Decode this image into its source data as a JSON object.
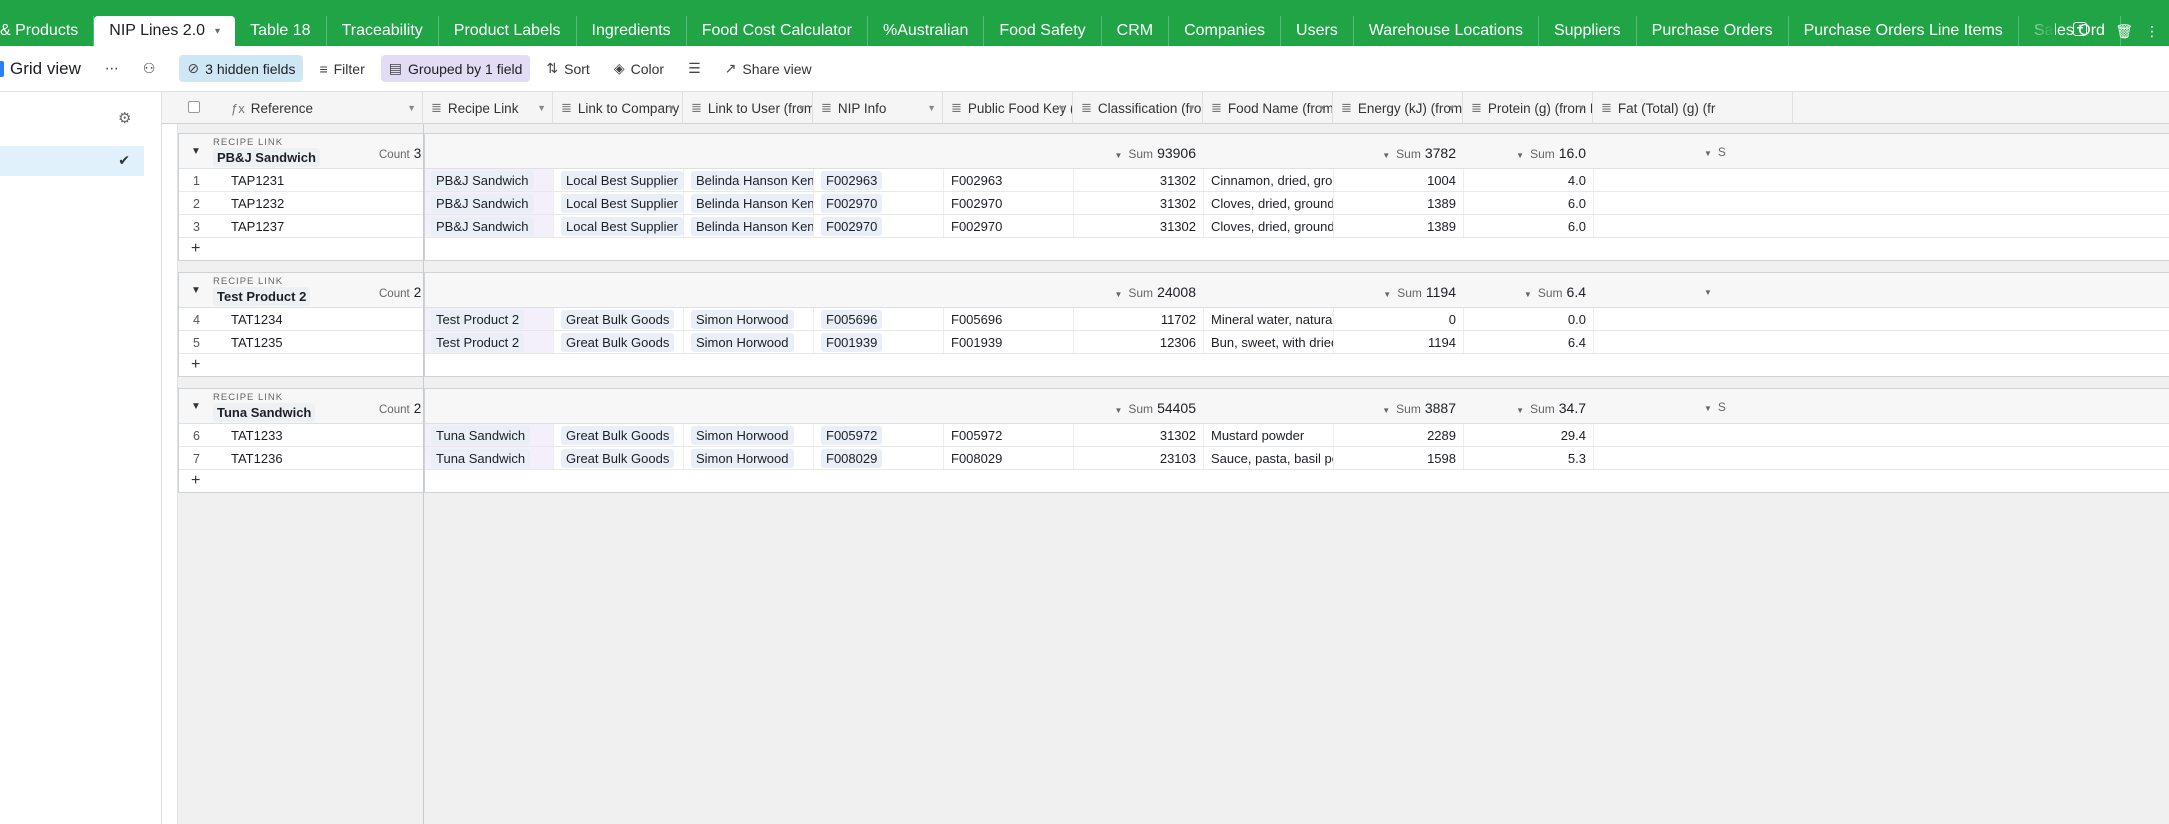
{
  "tabs": [
    {
      "label": "& Products"
    },
    {
      "label": "NIP Lines 2.0",
      "active": true
    },
    {
      "label": "Table 18"
    },
    {
      "label": "Traceability"
    },
    {
      "label": "Product Labels"
    },
    {
      "label": "Ingredients"
    },
    {
      "label": "Food Cost Calculator"
    },
    {
      "label": "%Australian"
    },
    {
      "label": "Food Safety"
    },
    {
      "label": "CRM"
    },
    {
      "label": "Companies"
    },
    {
      "label": "Users"
    },
    {
      "label": "Warehouse Locations"
    },
    {
      "label": "Suppliers"
    },
    {
      "label": "Purchase Orders"
    },
    {
      "label": "Purchase Orders Line Items"
    },
    {
      "label": "Sales Ord"
    }
  ],
  "viewbar": {
    "view_name": "Grid view",
    "hidden_fields": "3 hidden fields",
    "filter": "Filter",
    "grouped": "Grouped by 1 field",
    "sort": "Sort",
    "color": "Color",
    "share": "Share view"
  },
  "columns": [
    {
      "label": "Reference",
      "icon": "formula-icon"
    },
    {
      "label": "Recipe Link",
      "icon": "lines-icon"
    },
    {
      "label": "Link to Company (fr...",
      "icon": "lines-icon"
    },
    {
      "label": "Link to User (from ...",
      "icon": "lines-icon"
    },
    {
      "label": "NIP Info",
      "icon": "lines-icon"
    },
    {
      "label": "Public Food Key (fr...",
      "icon": "lines-icon"
    },
    {
      "label": "Classification (from...",
      "icon": "lines-icon"
    },
    {
      "label": "Food Name (from N...",
      "icon": "lines-icon"
    },
    {
      "label": "Energy (kJ) (from N...",
      "icon": "lines-icon"
    },
    {
      "label": "Protein (g) (from NI...",
      "icon": "lines-icon"
    },
    {
      "label": "Fat (Total) (g) (fr",
      "icon": "lines-icon"
    }
  ],
  "groups": [
    {
      "label": "RECIPE LINK",
      "name": "PB&J Sandwich",
      "count_label": "Count",
      "count": "3",
      "sum_label": "Sum",
      "sum_classification": "93906",
      "sum_energy": "3782",
      "sum_protein": "16.0",
      "sum_fat_partial": "S",
      "rows": [
        {
          "num": "1",
          "ref": "TAP1231",
          "recipe": "PB&J Sandwich",
          "company": "Local Best Supplier",
          "user": "Belinda Hanson Kenny",
          "nip": "F002963",
          "pfk": "F002963",
          "classification": "31302",
          "food": "Cinnamon, dried, ground",
          "energy": "1004",
          "protein": "4.0"
        },
        {
          "num": "2",
          "ref": "TAP1232",
          "recipe": "PB&J Sandwich",
          "company": "Local Best Supplier",
          "user": "Belinda Hanson Kenny",
          "nip": "F002970",
          "pfk": "F002970",
          "classification": "31302",
          "food": "Cloves, dried, ground",
          "energy": "1389",
          "protein": "6.0"
        },
        {
          "num": "3",
          "ref": "TAP1237",
          "recipe": "PB&J Sandwich",
          "company": "Local Best Supplier",
          "user": "Belinda Hanson Kenny",
          "nip": "F002970",
          "pfk": "F002970",
          "classification": "31302",
          "food": "Cloves, dried, ground",
          "energy": "1389",
          "protein": "6.0"
        }
      ]
    },
    {
      "label": "RECIPE LINK",
      "name": "Test Product 2",
      "count_label": "Count",
      "count": "2",
      "sum_label": "Sum",
      "sum_classification": "24008",
      "sum_energy": "1194",
      "sum_protein": "6.4",
      "sum_fat_partial": "",
      "rows": [
        {
          "num": "4",
          "ref": "TAT1234",
          "recipe": "Test Product 2",
          "company": "Great Bulk Goods",
          "user": "Simon Horwood",
          "nip": "F005696",
          "pfk": "F005696",
          "classification": "11702",
          "food": "Mineral water, natural, un...",
          "energy": "0",
          "protein": "0.0"
        },
        {
          "num": "5",
          "ref": "TAT1235",
          "recipe": "Test Product 2",
          "company": "Great Bulk Goods",
          "user": "Simon Horwood",
          "nip": "F001939",
          "pfk": "F001939",
          "classification": "12306",
          "food": "Bun, sweet, with dried fru...",
          "energy": "1194",
          "protein": "6.4"
        }
      ]
    },
    {
      "label": "RECIPE LINK",
      "name": "Tuna Sandwich",
      "count_label": "Count",
      "count": "2",
      "sum_label": "Sum",
      "sum_classification": "54405",
      "sum_energy": "3887",
      "sum_protein": "34.7",
      "sum_fat_partial": "S",
      "rows": [
        {
          "num": "6",
          "ref": "TAT1233",
          "recipe": "Tuna Sandwich",
          "company": "Great Bulk Goods",
          "user": "Simon Horwood",
          "nip": "F005972",
          "pfk": "F005972",
          "classification": "31302",
          "food": "Mustard powder",
          "energy": "2289",
          "protein": "29.4"
        },
        {
          "num": "7",
          "ref": "TAT1236",
          "recipe": "Tuna Sandwich",
          "company": "Great Bulk Goods",
          "user": "Simon Horwood",
          "nip": "F008029",
          "pfk": "F008029",
          "classification": "23103",
          "food": "Sauce, pasta, basil pesto,...",
          "energy": "1598",
          "protein": "5.3"
        }
      ]
    }
  ],
  "add_row_symbol": "+",
  "colors": {
    "header_green": "#20a446",
    "hidden_badge": "#cfe7f5",
    "grouped_badge": "#e3dcf5",
    "selected_row": "#e1f1fb"
  }
}
